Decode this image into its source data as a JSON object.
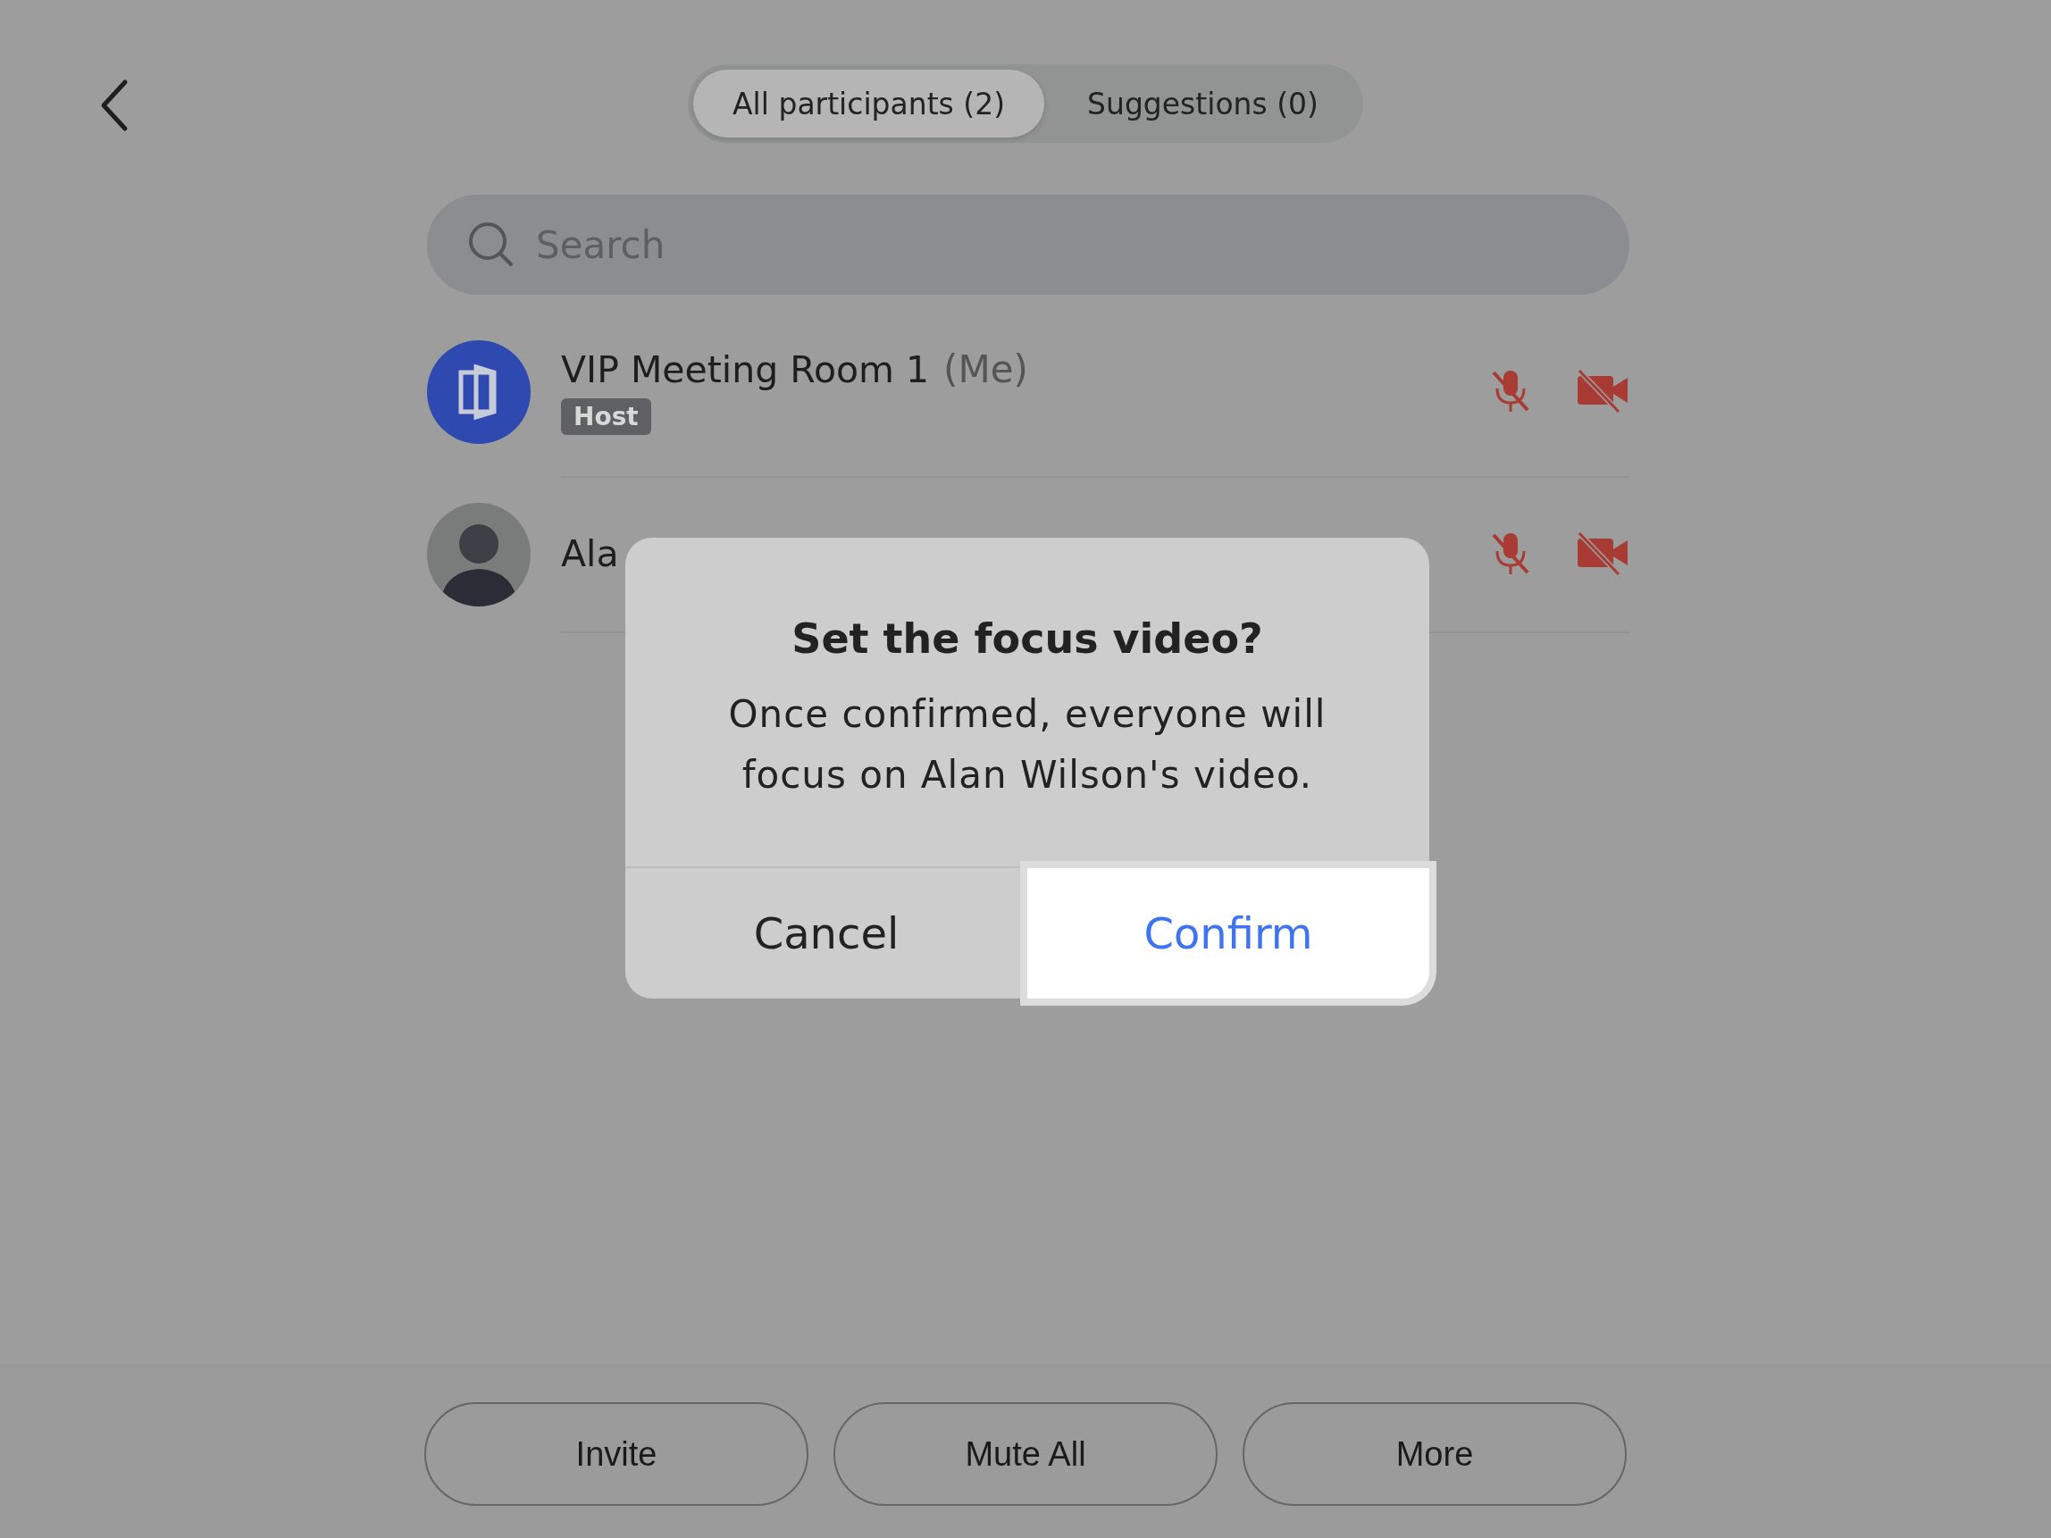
{
  "tabs": [
    {
      "label": "All participants (2)",
      "selected": true
    },
    {
      "label": "Suggestions (0)",
      "selected": false
    }
  ],
  "search": {
    "placeholder": "Search"
  },
  "participants": [
    {
      "name": "VIP Meeting Room 1",
      "suffix": "(Me)",
      "badge": "Host",
      "kind": "room",
      "muted": true,
      "video_off": true
    },
    {
      "name": "Ala",
      "kind": "photo",
      "muted": true,
      "video_off": true
    }
  ],
  "dialog": {
    "title": "Set the focus video?",
    "message": "Once confirmed, everyone will focus on Alan Wilson's video.",
    "buttons": [
      {
        "label": "Cancel",
        "kind": "default",
        "selected": false
      },
      {
        "label": "Confirm",
        "kind": "primary",
        "selected": true
      }
    ]
  },
  "footer": {
    "buttons": [
      "Invite",
      "Mute All",
      "More"
    ]
  }
}
